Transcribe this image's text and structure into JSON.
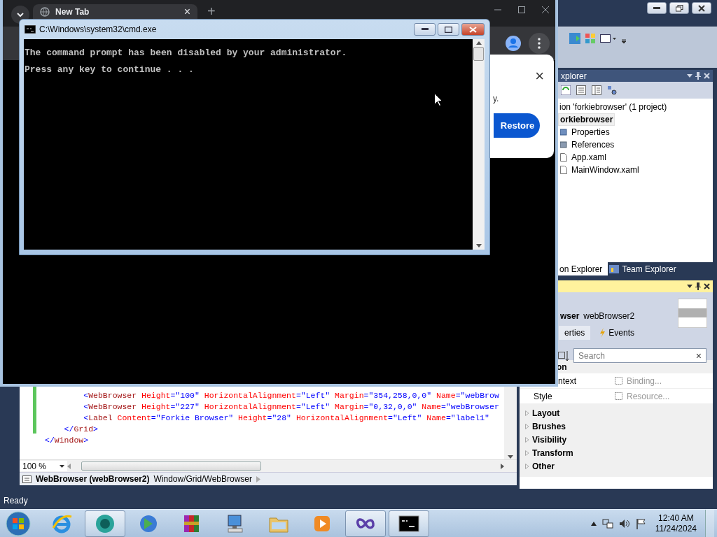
{
  "chrome": {
    "tab": {
      "title": "New Tab",
      "close": "×"
    },
    "new_tab": "+",
    "dialog": {
      "close": "×",
      "text": "y.",
      "button": "Restore"
    }
  },
  "cmd": {
    "title": "C:\\Windows\\system32\\cmd.exe",
    "lines": [
      "The command prompt has been disabled by your administrator.",
      "Press any key to continue . . ."
    ]
  },
  "solution_explorer": {
    "title": "xplorer",
    "items": [
      {
        "label": "ion 'forkiebrowser' (1 project)",
        "selected": false,
        "children": [
          {
            "label": "orkiebrowser",
            "selected": true,
            "children": [
              {
                "label": "Properties",
                "kind": "properties",
                "selected": false
              },
              {
                "label": "References",
                "kind": "references",
                "selected": false
              },
              {
                "label": "App.xaml",
                "kind": "file",
                "selected": false
              },
              {
                "label": "MainWindow.xaml",
                "kind": "file",
                "selected": false
              }
            ]
          }
        ]
      }
    ],
    "tabs": [
      {
        "label": "on Explorer",
        "selected": true
      },
      {
        "label": "Team Explorer",
        "selected": false
      }
    ]
  },
  "properties": {
    "type": "wser",
    "name": "webBrowser2",
    "tabs": [
      {
        "label": "erties",
        "selected": true
      },
      {
        "label": "Events",
        "selected": false
      }
    ],
    "search": {
      "placeholder": "Search",
      "clear": "×"
    },
    "section": "on",
    "rows": [
      {
        "name": "ntext",
        "value": "Binding..."
      },
      {
        "name": "Style",
        "value": "Resource..."
      }
    ],
    "categories": [
      "Layout",
      "Brushes",
      "Visibility",
      "Transform",
      "Other"
    ]
  },
  "editor": {
    "lines": [
      [
        {
          "kind": "punct",
          "text": "        <"
        },
        {
          "kind": "tag",
          "text": "WebBrowser"
        },
        {
          "kind": "attr",
          "text": " Height"
        },
        {
          "kind": "punct",
          "text": "=\"100\""
        },
        {
          "kind": "attr",
          "text": " HorizontalAlignment"
        },
        {
          "kind": "punct",
          "text": "=\"Left\""
        },
        {
          "kind": "attr",
          "text": " Margin"
        },
        {
          "kind": "punct",
          "text": "=\"354,258,0,0\""
        },
        {
          "kind": "attr",
          "text": " Name"
        },
        {
          "kind": "punct",
          "text": "=\"webBrow"
        }
      ],
      [
        {
          "kind": "punct",
          "text": "        <"
        },
        {
          "kind": "tag",
          "text": "WebBrowser"
        },
        {
          "kind": "attr",
          "text": " Height"
        },
        {
          "kind": "punct",
          "text": "=\"227\""
        },
        {
          "kind": "attr",
          "text": " HorizontalAlignment"
        },
        {
          "kind": "punct",
          "text": "=\"Left\""
        },
        {
          "kind": "attr",
          "text": " Margin"
        },
        {
          "kind": "punct",
          "text": "=\"0,32,0,0\""
        },
        {
          "kind": "attr",
          "text": " Name"
        },
        {
          "kind": "punct",
          "text": "=\"webBrowser"
        }
      ],
      [
        {
          "kind": "punct",
          "text": "        <"
        },
        {
          "kind": "tag",
          "text": "Label"
        },
        {
          "kind": "attr",
          "text": " Content"
        },
        {
          "kind": "punct",
          "text": "=\"Forkie Browser\""
        },
        {
          "kind": "attr",
          "text": " Height"
        },
        {
          "kind": "punct",
          "text": "=\"28\""
        },
        {
          "kind": "attr",
          "text": " HorizontalAlignment"
        },
        {
          "kind": "punct",
          "text": "=\"Left\""
        },
        {
          "kind": "attr",
          "text": " Name"
        },
        {
          "kind": "punct",
          "text": "=\"label1\""
        }
      ],
      [
        {
          "kind": "punct",
          "text": "    </"
        },
        {
          "kind": "tag",
          "text": "Grid"
        },
        {
          "kind": "punct",
          "text": ">"
        }
      ],
      [
        {
          "kind": "punct",
          "text": "</"
        },
        {
          "kind": "tag",
          "text": "Window"
        },
        {
          "kind": "punct",
          "text": ">"
        }
      ]
    ],
    "zoom": "100 %",
    "breadcrumb": {
      "element": "WebBrowser (webBrowser2)",
      "path": "Window/Grid/WebBrowser"
    }
  },
  "status_bar": "Ready",
  "taskbar": {
    "items": [
      {
        "kind": "ie",
        "open": false
      },
      {
        "kind": "app",
        "open": true
      },
      {
        "kind": "download",
        "open": false
      },
      {
        "kind": "archive",
        "open": false
      },
      {
        "kind": "computer",
        "open": false
      },
      {
        "kind": "folder",
        "open": false
      },
      {
        "kind": "media",
        "open": false
      },
      {
        "kind": "studio",
        "open": true
      },
      {
        "kind": "console",
        "open": true
      }
    ],
    "clock": {
      "time": "12:40 AM",
      "date": "11/24/2024"
    }
  }
}
